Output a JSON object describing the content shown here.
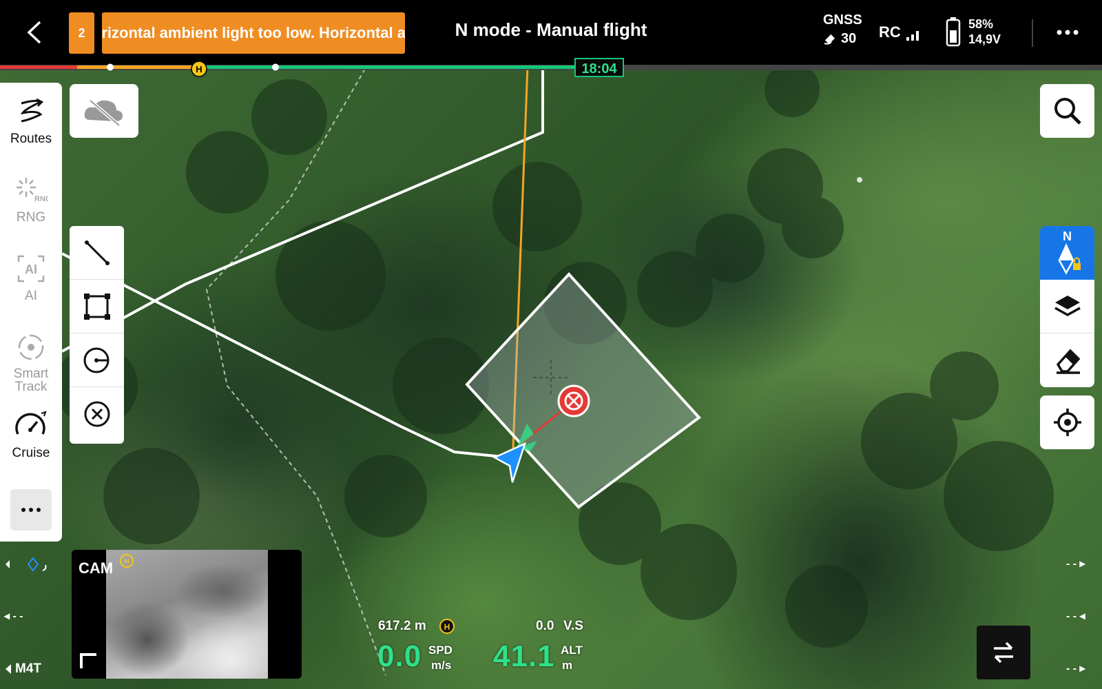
{
  "header": {
    "warning_count": "2",
    "warning_message": "Horizontal ambient light too low. Horizontal ambient light too low.",
    "mode_title": "N mode - Manual flight",
    "gnss_label": "GNSS",
    "gnss_satellites": "30",
    "rc_label": "RC",
    "battery_percent": "58%",
    "battery_voltage": "14,9V"
  },
  "timeline": {
    "remaining_time": "18:04"
  },
  "left_panel": {
    "items": [
      {
        "label": "Routes",
        "icon": "routes-icon"
      },
      {
        "label": "RNG",
        "icon": "rng-icon"
      },
      {
        "label": "AI",
        "icon": "ai-icon"
      },
      {
        "label": "Smart Track",
        "icon": "smart-track-icon"
      },
      {
        "label": "Cruise",
        "icon": "cruise-icon"
      }
    ],
    "rng_icon_text": "RNG",
    "ai_icon_text": "AI"
  },
  "right_panel": {
    "north_label": "N"
  },
  "camera": {
    "label": "CAM",
    "model": "M4T"
  },
  "telemetry": {
    "distance": "617.2 m",
    "vertical_speed": "0.0",
    "vs_label": "V.S",
    "speed": "0.0",
    "speed_label": "SPD",
    "speed_unit": "m/s",
    "altitude": "41.1",
    "alt_label": "ALT",
    "alt_unit": "m"
  },
  "edge_markers": {
    "dash": "- -"
  },
  "colors": {
    "warning": "#ef8d23",
    "accent_green": "#2fe08a",
    "compass_blue": "#1676e8"
  }
}
